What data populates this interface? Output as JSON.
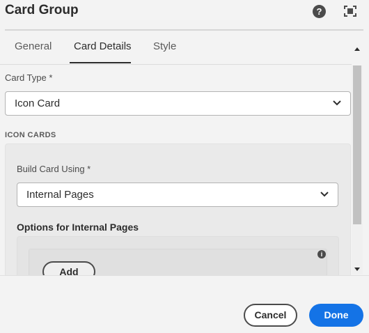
{
  "dialog": {
    "title": "Card Group",
    "help_icon": "help-icon",
    "fullscreen_icon": "fullscreen-icon"
  },
  "tabs": [
    {
      "label": "General",
      "active": false
    },
    {
      "label": "Card Details",
      "active": true
    },
    {
      "label": "Style",
      "active": false
    }
  ],
  "form": {
    "card_type": {
      "label": "Card Type *",
      "value": "Icon Card"
    },
    "section_heading": "ICON CARDS",
    "build_card_using": {
      "label": "Build Card Using *",
      "value": "Internal Pages"
    },
    "options_heading": "Options for Internal Pages",
    "info_icon": "info-icon",
    "add_label": "Add"
  },
  "footer": {
    "cancel_label": "Cancel",
    "done_label": "Done"
  },
  "colors": {
    "primary": "#1473e6",
    "background": "#f3f3f3",
    "text": "#2c2c2c"
  }
}
